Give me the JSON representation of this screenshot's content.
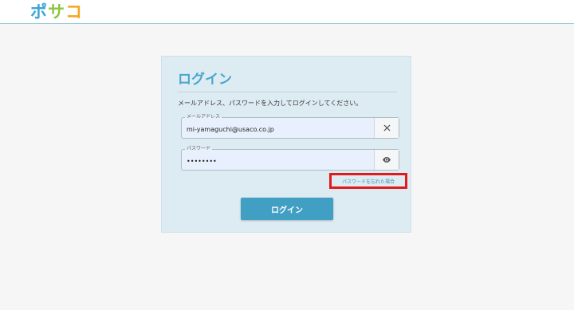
{
  "header": {
    "logo_text": "ポサコ",
    "logo_colors": [
      "#3aa5d6",
      "#8cc63f",
      "#f4a71d"
    ]
  },
  "login": {
    "title": "ログイン",
    "description": "メールアドレス、パスワードを入力してログインしてください。",
    "email": {
      "label": "メールアドレス",
      "value": "mi-yamaguchi@usaco.co.jp",
      "clear_icon": "close-icon"
    },
    "password": {
      "label": "パスワード",
      "value": "password",
      "toggle_icon": "eye-icon"
    },
    "forgot_link": "パスワードを忘れた場合",
    "submit_label": "ログイン"
  },
  "colors": {
    "accent": "#419fc4",
    "highlight_box": "#e31a1a",
    "card_background": "#ddebf2"
  }
}
